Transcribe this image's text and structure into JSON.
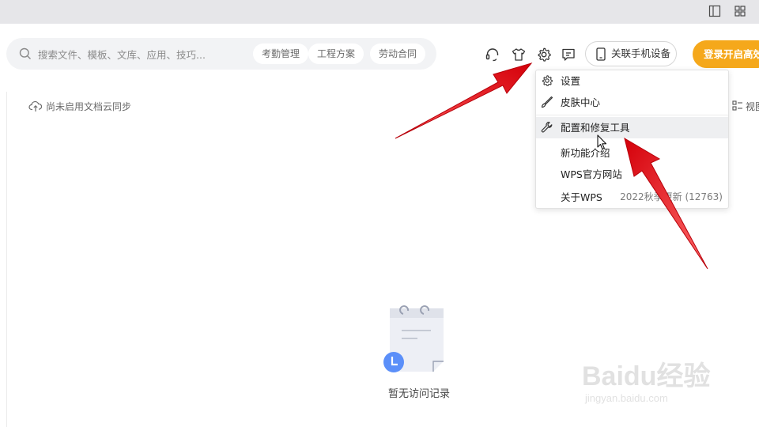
{
  "titlebar": {
    "icons": [
      "sidebar-layout-icon",
      "grid-apps-icon"
    ]
  },
  "search": {
    "placeholder": "搜索文件、模板、文库、应用、技巧...",
    "chips": [
      "考勤管理",
      "工程方案",
      "劳动合同"
    ]
  },
  "header": {
    "icons": [
      "headset-icon",
      "tshirt-skin-icon",
      "settings-gear-icon",
      "feedback-message-icon"
    ],
    "phone_button": "关联手机设备",
    "login_button": "登录开启高效"
  },
  "content": {
    "cloud_sync_text": "尚未启用文档云同步",
    "view_label": "视图",
    "empty_label": "暂无访问记录"
  },
  "menu": {
    "items": [
      {
        "label": "设置",
        "icon": "gear-icon"
      },
      {
        "label": "皮肤中心",
        "icon": "brush-icon"
      },
      {
        "label": "配置和修复工具",
        "icon": "wrench-icon",
        "highlighted": true
      },
      {
        "label": "新功能介绍",
        "icon": ""
      },
      {
        "label": "WPS官方网站",
        "icon": ""
      },
      {
        "label": "关于WPS",
        "icon": "",
        "right": "2022秋季更新 (12763)"
      }
    ]
  },
  "watermark": {
    "line1": "Baidu经验",
    "line2": "jingyan.baidu.com"
  },
  "colors": {
    "accent_orange": "#f5a81b",
    "annotation_red": "#e8141b",
    "empty_badge_blue": "#5b8ff9"
  }
}
